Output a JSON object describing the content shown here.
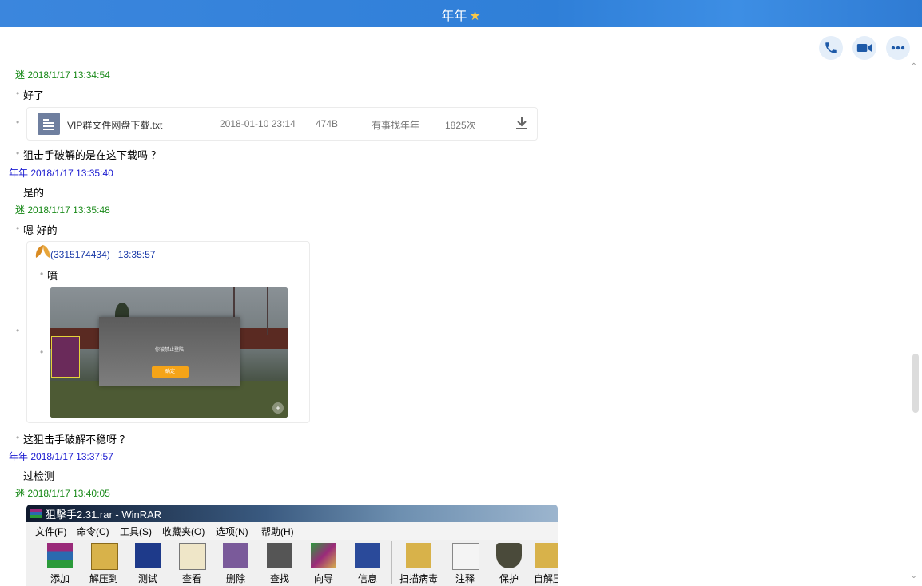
{
  "window": {
    "title": "年年",
    "title_star": "★"
  },
  "header_actions": [
    {
      "name": "phone-call-button",
      "icon": "phone-icon"
    },
    {
      "name": "video-call-button",
      "icon": "video-camera-icon"
    },
    {
      "name": "more-options-button",
      "icon": "more-dots-icon"
    }
  ],
  "messages": [
    {
      "sender": "迷",
      "time": "2018/1/17 13:34:54"
    },
    {
      "text": "好了"
    },
    {
      "text": "狙击手破解的是在这下载吗 ？"
    },
    {
      "sender": "年年",
      "time": "2018/1/17 13:35:40"
    },
    {
      "text": "是的"
    },
    {
      "sender": "迷",
      "time": "2018/1/17 13:35:48"
    },
    {
      "text": "嗯 好的"
    },
    {
      "text": "这狙击手破解不稳呀 ？"
    },
    {
      "sender": "年年",
      "time": "2018/1/17 13:37:57"
    },
    {
      "text": "过检测"
    },
    {
      "sender": "迷",
      "time": "2018/1/17 13:40:05"
    }
  ],
  "file": {
    "name": "VIP群文件网盘下载.txt",
    "date": "2018-01-10 23:14",
    "size": "474B",
    "uploader": "有事找年年",
    "downloads": "1825次"
  },
  "quote": {
    "uid": "3315174434",
    "time": "13:35:57",
    "text": "噴",
    "dialog_text": "你被禁止登陆",
    "dialog_button": "确定"
  },
  "winrar": {
    "title": "狙擊手2.31.rar - WinRAR",
    "menu": [
      "文件(F)",
      "命令(C)",
      "工具(S)",
      "收藏夹(O)",
      "选项(N)",
      "帮助(H)"
    ],
    "tools": [
      "添加",
      "解压到",
      "测试",
      "查看",
      "删除",
      "查找",
      "向导",
      "信息",
      "扫描病毒",
      "注释",
      "保护",
      "自解压"
    ]
  }
}
